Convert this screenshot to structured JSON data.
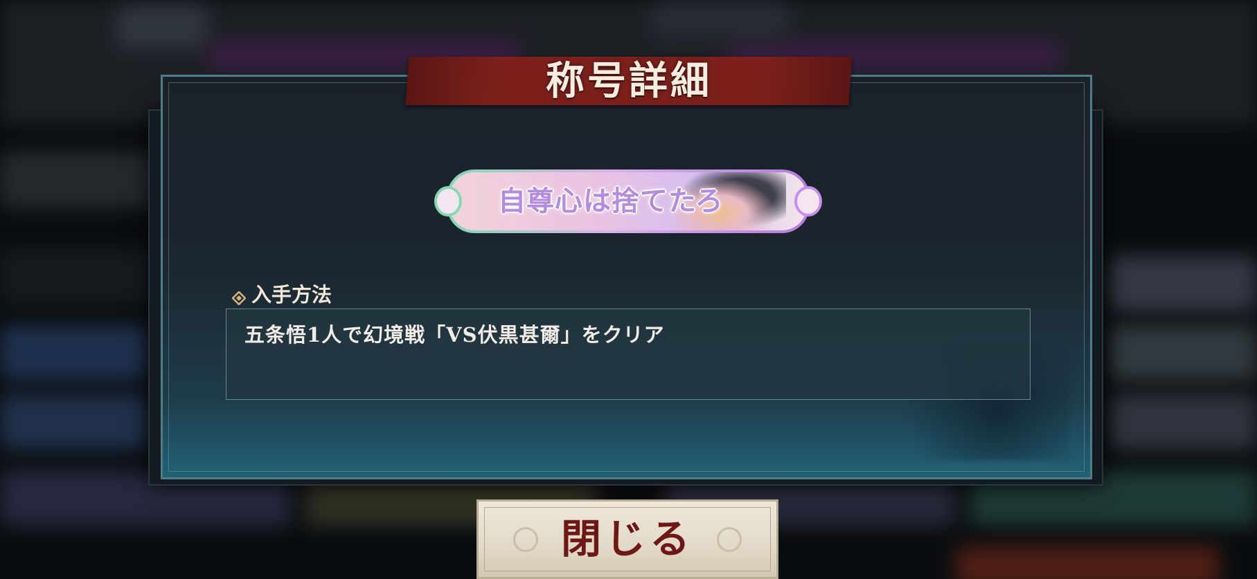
{
  "dialog": {
    "title": "称号詳細",
    "title_plate": {
      "text": "自尊心は捨てたろ",
      "colors": {
        "gradient_start": "#7fd9b4",
        "gradient_end": "#b77be0",
        "text": "#b58be0"
      }
    },
    "acquisition": {
      "label": "入手方法",
      "icon": "diamond-icon",
      "description": "五条悟1人で幻境戦「VS伏黒甚爾」をクリア"
    },
    "close_button": {
      "label": "閉じる"
    }
  },
  "colors": {
    "banner": "#7d201b",
    "panel_border": "#4f7e88",
    "close_text": "#6d1717",
    "accent_gold": "#d9b57a"
  }
}
